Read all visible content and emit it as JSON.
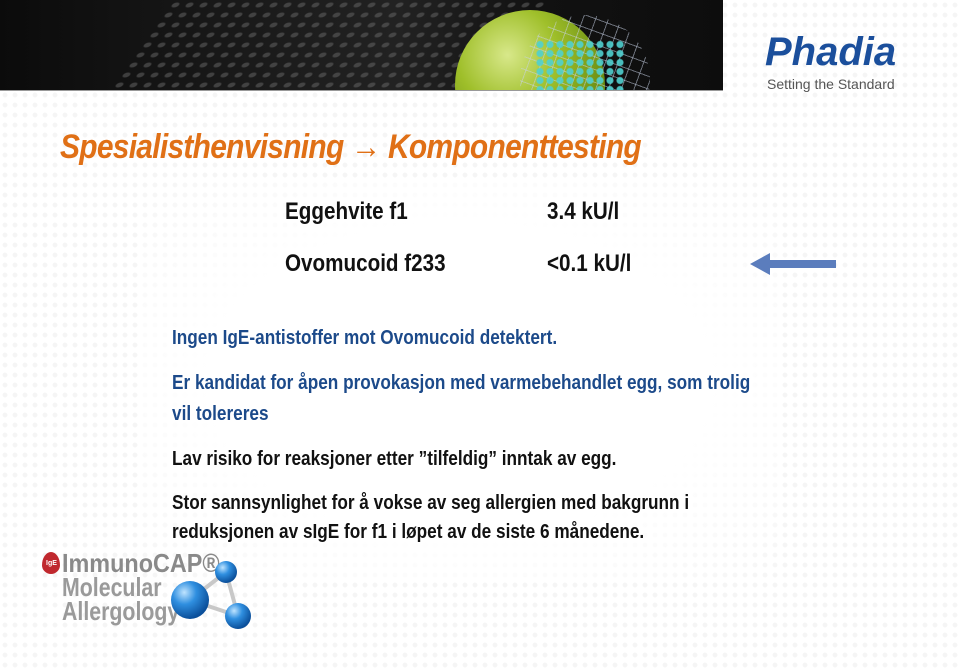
{
  "header": {
    "banner_image": "egg-molecule-banner",
    "logo": {
      "name": "Phadia",
      "tagline": "Setting the Standard",
      "color": "#1b4f9c"
    }
  },
  "title": {
    "text": "Spesialisthenvisning → Komponenttesting",
    "color": "#e07016"
  },
  "results": [
    {
      "component": "Eggehvite f1",
      "value": "3.4 kU/l"
    },
    {
      "component": "Ovomucoid f233",
      "value": "<0.1 kU/l",
      "highlight_icon": "arrow-left-icon"
    }
  ],
  "findings": [
    {
      "text": "Ingen IgE-antistoffer mot Ovomucoid detektert.",
      "color": "#1c4a8a"
    },
    {
      "text": "Er kandidat for åpen provokasjon med varmebehandlet egg, som trolig",
      "color": "#1c4a8a"
    },
    {
      "text": "vil tolereres",
      "color": "#1c4a8a"
    },
    {
      "text": "Lav risiko for reaksjoner etter ”tilfeldig” inntak av egg.",
      "color": "#111111"
    },
    {
      "text": "Stor sannsynlighet for å vokse av seg allergien med bakgrunn i",
      "color": "#111111"
    },
    {
      "text": "reduksjonen av sIgE for f1 i løpet av de siste 6 månedene.",
      "color": "#111111"
    }
  ],
  "footer_logo": {
    "badge": "IgE",
    "brand": "ImmunoCAP®",
    "line2": "Molecular",
    "line3": "Allergology",
    "icon": "molecule-icon"
  },
  "colors": {
    "arrow": "#5b7dbd"
  }
}
